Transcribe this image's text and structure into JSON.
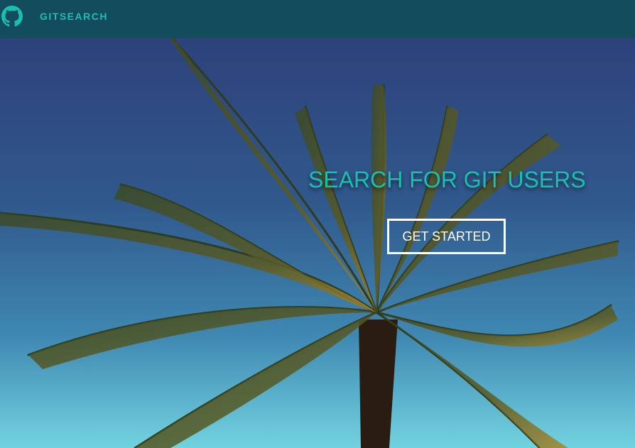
{
  "navbar": {
    "logo_icon": "github-icon",
    "brand": "GITSEARCH"
  },
  "hero": {
    "background": "palm-tree-sky-photo",
    "title": "SEARCH FOR GIT USERS",
    "cta_label": "GET STARTED"
  },
  "colors": {
    "accent": "#1bbfb0",
    "navbar": "#124e5c",
    "cta_border": "#ffffff"
  }
}
